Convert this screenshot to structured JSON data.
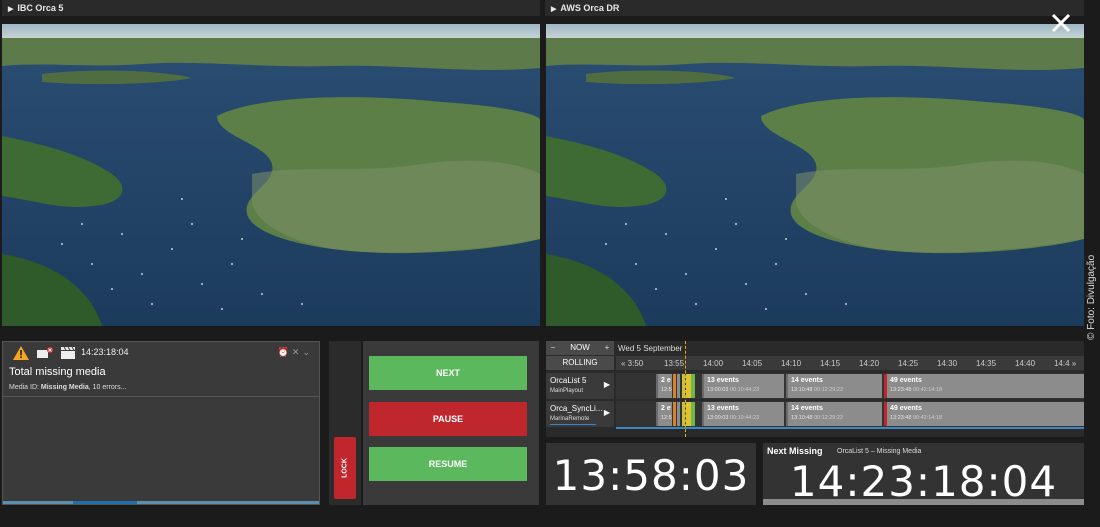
{
  "panes": {
    "left_title": "IBC Orca 5",
    "right_title": "AWS Orca DR"
  },
  "photo_credit": "© Foto: Divulgação",
  "alert": {
    "time": "14:23:18:04",
    "title": "Total missing media",
    "subtitle_prefix": "Media ID: ",
    "subtitle_bold": "Missing Media",
    "subtitle_suffix": ", 10 errors..."
  },
  "controls": {
    "next": "NEXT",
    "pause": "PAUSE",
    "resume": "RESUME",
    "lock": "LOCK"
  },
  "timeline": {
    "now_label": "NOW",
    "minus": "−",
    "plus": "+",
    "rolling_label": "ROLLING",
    "date": "Wed 5 September",
    "ticks": [
      "« 3:50",
      "13:55",
      "14:00",
      "14:05",
      "14:10",
      "14:15",
      "14:20",
      "14:25",
      "14:30",
      "14:35",
      "14:40",
      "14:4 »"
    ],
    "rows": [
      {
        "name": "OrcaList 5",
        "sub": "MainPlayout",
        "events": [
          {
            "title": "2 e",
            "time": "12:5",
            "dur": ""
          },
          {
            "title": "13 events",
            "time": "13:00:03",
            "dur": "00:10:44:23"
          },
          {
            "title": "14 events",
            "time": "13:10:48",
            "dur": "00:12:29:22"
          },
          {
            "title": "49 events",
            "time": "13:23:48",
            "dur": "00:42:14:18"
          }
        ]
      },
      {
        "name": "Orca_SyncLi...",
        "sub": "MarinaRemote",
        "events": [
          {
            "title": "2 e",
            "time": "12:5",
            "dur": ""
          },
          {
            "title": "13 events",
            "time": "13:00:03",
            "dur": "00:10:44:23"
          },
          {
            "title": "14 events",
            "time": "13:10:48",
            "dur": "00:12:29:22"
          },
          {
            "title": "49 events",
            "time": "13:23:48",
            "dur": "00:42:14:18"
          }
        ]
      }
    ]
  },
  "clock": {
    "current": "13:58:03",
    "next_label": "Next Missing",
    "next_detail": "OrcaList 5  –  Missing Media",
    "next_time": "14:23:18:04"
  },
  "colors": {
    "green": "#5cb85c",
    "red": "#c0272d",
    "accent_blue": "#3b86c5",
    "now_line": "#e6b400"
  },
  "icons": {
    "close": "close-icon",
    "warning": "warning-icon",
    "media_error": "media-error-icon",
    "clapper": "clapperboard-icon"
  }
}
